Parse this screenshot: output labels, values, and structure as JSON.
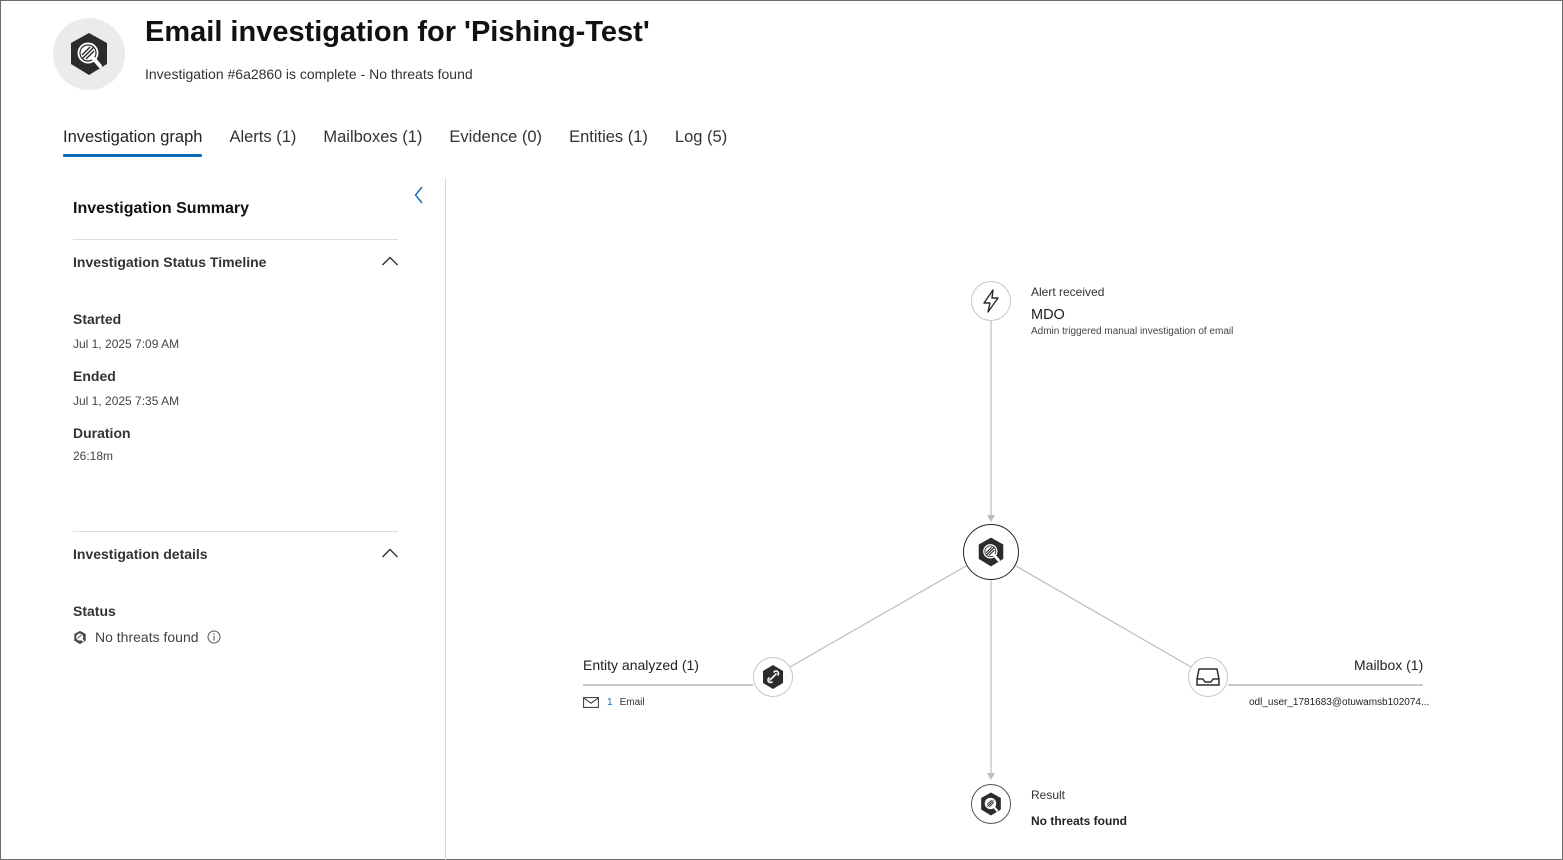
{
  "header": {
    "title": "Email investigation for 'Pishing-Test'",
    "subtitle": "Investigation #6a2860 is complete - No threats found",
    "icon": "investigation-icon"
  },
  "tabs": [
    {
      "label": "Investigation graph",
      "active": true
    },
    {
      "label": "Alerts (1)",
      "active": false
    },
    {
      "label": "Mailboxes (1)",
      "active": false
    },
    {
      "label": "Evidence (0)",
      "active": false
    },
    {
      "label": "Entities (1)",
      "active": false
    },
    {
      "label": "Log (5)",
      "active": false
    }
  ],
  "summary": {
    "title": "Investigation Summary",
    "timeline": {
      "heading": "Investigation Status Timeline",
      "started_label": "Started",
      "started_value": "Jul 1, 2025 7:09 AM",
      "ended_label": "Ended",
      "ended_value": "Jul 1, 2025 7:35 AM",
      "duration_label": "Duration",
      "duration_value": "26:18m"
    },
    "details": {
      "heading": "Investigation details",
      "status_label": "Status",
      "status_value": "No threats found"
    }
  },
  "graph": {
    "alert": {
      "caption": "Alert received",
      "name": "MDO",
      "description": "Admin triggered manual investigation of email",
      "icon": "lightning-icon"
    },
    "entity": {
      "label": "Entity analyzed (1)",
      "count": "1",
      "type": "Email",
      "icon": "entity-icon"
    },
    "mailbox": {
      "label": "Mailbox (1)",
      "address": "odl_user_1781683@otuwamsb102074...",
      "icon": "inbox-icon"
    },
    "result": {
      "caption": "Result",
      "value": "No threats found"
    }
  },
  "colors": {
    "accent": "#0f6cbd",
    "edge": "#bdbdbd",
    "icon_dark": "#2b2b2b"
  }
}
